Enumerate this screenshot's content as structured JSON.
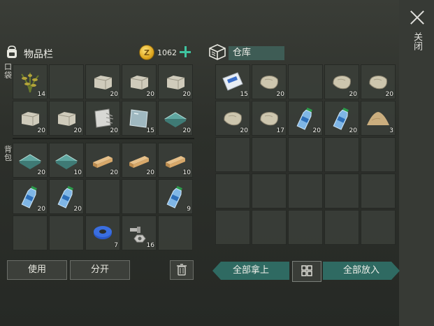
{
  "close": {
    "label": "关闭"
  },
  "inventory": {
    "title": "物品栏",
    "pocket_label": "口袋",
    "backpack_label": "背包"
  },
  "currency": {
    "coin_symbol": "Z",
    "amount": "1062"
  },
  "pocket_slots": [
    {
      "item": "plant",
      "count": "14"
    },
    {
      "item": "empty",
      "count": ""
    },
    {
      "item": "stone-block",
      "count": "20"
    },
    {
      "item": "stone-block",
      "count": "20"
    },
    {
      "item": "stone-block",
      "count": "20"
    },
    {
      "item": "stone-block",
      "count": "20"
    },
    {
      "item": "stone-block",
      "count": "20"
    },
    {
      "item": "metal-scrap",
      "count": "20"
    },
    {
      "item": "glass-pane",
      "count": "15"
    },
    {
      "item": "glass-sheet",
      "count": "20"
    }
  ],
  "backpack_slots": [
    {
      "item": "glass-sheet",
      "count": "20"
    },
    {
      "item": "glass-sheet",
      "count": "10"
    },
    {
      "item": "wood-plank",
      "count": "20"
    },
    {
      "item": "wood-plank",
      "count": "20"
    },
    {
      "item": "wood-plank",
      "count": "10"
    },
    {
      "item": "water-bottle",
      "count": "20"
    },
    {
      "item": "water-bottle",
      "count": "20"
    },
    {
      "item": "empty",
      "count": ""
    },
    {
      "item": "empty",
      "count": ""
    },
    {
      "item": "water-bottle",
      "count": "9"
    },
    {
      "item": "empty",
      "count": ""
    },
    {
      "item": "empty",
      "count": ""
    },
    {
      "item": "tape",
      "count": "7"
    },
    {
      "item": "bolts",
      "count": "16"
    },
    {
      "item": "empty",
      "count": ""
    }
  ],
  "warehouse": {
    "title": "仓库",
    "slots": [
      {
        "item": "cement-bag",
        "count": "15"
      },
      {
        "item": "rock",
        "count": "20"
      },
      {
        "item": "empty",
        "count": ""
      },
      {
        "item": "rock",
        "count": "20"
      },
      {
        "item": "rock",
        "count": "20"
      },
      {
        "item": "rock",
        "count": "20"
      },
      {
        "item": "rock",
        "count": "17"
      },
      {
        "item": "water-bottle",
        "count": "20"
      },
      {
        "item": "water-bottle",
        "count": "20"
      },
      {
        "item": "sand-pile",
        "count": "3"
      },
      {
        "item": "empty",
        "count": ""
      },
      {
        "item": "empty",
        "count": ""
      },
      {
        "item": "empty",
        "count": ""
      },
      {
        "item": "empty",
        "count": ""
      },
      {
        "item": "empty",
        "count": ""
      },
      {
        "item": "empty",
        "count": ""
      },
      {
        "item": "empty",
        "count": ""
      },
      {
        "item": "empty",
        "count": ""
      },
      {
        "item": "empty",
        "count": ""
      },
      {
        "item": "empty",
        "count": ""
      },
      {
        "item": "empty",
        "count": ""
      },
      {
        "item": "empty",
        "count": ""
      },
      {
        "item": "empty",
        "count": ""
      },
      {
        "item": "empty",
        "count": ""
      },
      {
        "item": "empty",
        "count": ""
      }
    ]
  },
  "actions": {
    "use": "使用",
    "split": "分开",
    "take_all": "全部拿上",
    "put_all": "全部放入"
  },
  "icons": {
    "close": "close-icon",
    "backpack": "backpack-icon",
    "trash": "trash-icon",
    "warehouse": "warehouse-icon",
    "grid": "grid-view-icon",
    "coin": "coin-icon",
    "add": "plus-icon"
  }
}
